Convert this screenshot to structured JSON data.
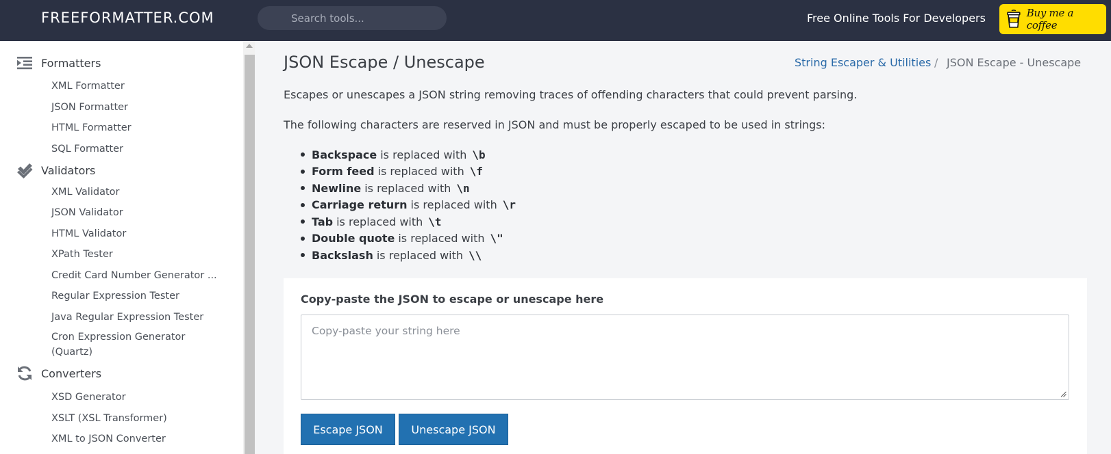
{
  "header": {
    "brand": "FREEFORMATTER.COM",
    "search_placeholder": "Search tools...",
    "tagline": "Free Online Tools For Developers",
    "coffee_label": "Buy me a coffee",
    "coffee_color": "#ffdd00",
    "background": "#2b3143"
  },
  "sidebar": {
    "sections": [
      {
        "label": "Formatters",
        "icon": "indent-icon",
        "items": [
          "XML Formatter",
          "JSON Formatter",
          "HTML Formatter",
          "SQL Formatter"
        ]
      },
      {
        "label": "Validators",
        "icon": "double-check-icon",
        "items": [
          "XML Validator",
          "JSON Validator",
          "HTML Validator",
          "XPath Tester",
          "Credit Card Number Generator ...",
          "Regular Expression Tester",
          "Java Regular Expression Tester",
          "Cron Expression Generator (Quartz)"
        ]
      },
      {
        "label": "Converters",
        "icon": "refresh-icon",
        "items": [
          "XSD Generator",
          "XSLT (XSL Transformer)",
          "XML to JSON Converter"
        ]
      }
    ]
  },
  "main": {
    "title": "JSON Escape / Unescape",
    "breadcrumb": {
      "link": "String Escaper & Utilities",
      "separator": "/",
      "current": "JSON Escape - Unescape"
    },
    "description": "Escapes or unescapes a JSON string removing traces of offending characters that could prevent parsing.",
    "reserved_intro": "The following characters are reserved in JSON and must be properly escaped to be used in strings:",
    "reserved": [
      {
        "name": "Backspace",
        "text": "is replaced with",
        "code": "\\b"
      },
      {
        "name": "Form feed",
        "text": "is replaced with",
        "code": "\\f"
      },
      {
        "name": "Newline",
        "text": "is replaced with",
        "code": "\\n"
      },
      {
        "name": "Carriage return",
        "text": "is replaced with",
        "code": "\\r"
      },
      {
        "name": "Tab",
        "text": "is replaced with",
        "code": "\\t"
      },
      {
        "name": "Double quote",
        "text": "is replaced with",
        "code": "\\\""
      },
      {
        "name": "Backslash",
        "text": "is replaced with",
        "code": "\\\\"
      }
    ],
    "input_label": "Copy-paste the JSON to escape or unescape here",
    "input_placeholder": "Copy-paste your string here",
    "input_value": "",
    "escape_button": "Escape JSON",
    "unescape_button": "Unescape JSON",
    "accent_color": "#2271b1",
    "link_color": "#2a6aa8"
  }
}
